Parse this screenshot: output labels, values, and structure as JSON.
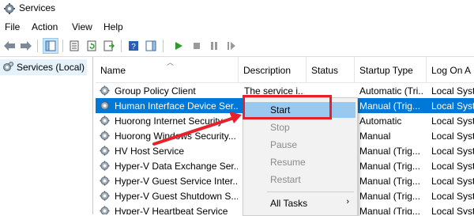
{
  "window": {
    "title": "Services",
    "icon": "services-gear-icon"
  },
  "menu": {
    "items": [
      "File",
      "Action",
      "View",
      "Help"
    ]
  },
  "toolbar": {
    "icons": [
      "back-icon",
      "forward-icon",
      "show-hide-tree-icon",
      "properties-icon",
      "refresh-icon",
      "export-list-icon",
      "help-icon",
      "show-action-pane-icon",
      "play-icon",
      "stop-icon",
      "pause-icon",
      "resume-icon"
    ]
  },
  "tree": {
    "selected_label": "Services (Local)"
  },
  "columns": [
    "Name",
    "Description",
    "Status",
    "Startup Type",
    "Log On A"
  ],
  "services": [
    {
      "name": "Group Policy Client",
      "description": "The service i...",
      "status": "",
      "startup": "Automatic (Tri...",
      "logon": "Local Syst",
      "selected": false
    },
    {
      "name": "Human Interface Device Ser...",
      "description": "",
      "status": "",
      "startup": "Manual (Trig...",
      "logon": "Local Syst",
      "selected": true
    },
    {
      "name": "Huorong Internet Security",
      "description": "",
      "status": "",
      "startup": "Automatic",
      "logon": "Local Syst",
      "selected": false
    },
    {
      "name": "Huorong Windows Security...",
      "description": "",
      "status": "",
      "startup": "Manual",
      "logon": "Local Syst",
      "selected": false
    },
    {
      "name": "HV Host Service",
      "description": "",
      "status": "",
      "startup": "Manual (Trig...",
      "logon": "Local Syst",
      "selected": false
    },
    {
      "name": "Hyper-V Data Exchange Ser...",
      "description": "",
      "status": "",
      "startup": "Manual (Trig...",
      "logon": "Local Syst",
      "selected": false
    },
    {
      "name": "Hyper-V Guest Service Inter...",
      "description": "",
      "status": "",
      "startup": "Manual (Trig...",
      "logon": "Local Syst",
      "selected": false
    },
    {
      "name": "Hyper-V Guest Shutdown S...",
      "description": "",
      "status": "",
      "startup": "Manual (Trig...",
      "logon": "Local Syst",
      "selected": false
    },
    {
      "name": "Hyper-V Heartbeat Service",
      "description": "",
      "status": "",
      "startup": "Manual (Trig...",
      "logon": "Local Syst",
      "selected": false
    }
  ],
  "context_menu": {
    "start": "Start",
    "stop": "Stop",
    "pause": "Pause",
    "resume": "Resume",
    "restart": "Restart",
    "all_tasks": "All Tasks",
    "submenu_arrow": "›"
  },
  "annotation": {
    "color": "#e8202a"
  },
  "colors": {
    "selection": "#0078d7",
    "menu_hot": "#99c9ef",
    "tree_selected": "#e5f1fb",
    "play_green": "#2e9a2e"
  }
}
